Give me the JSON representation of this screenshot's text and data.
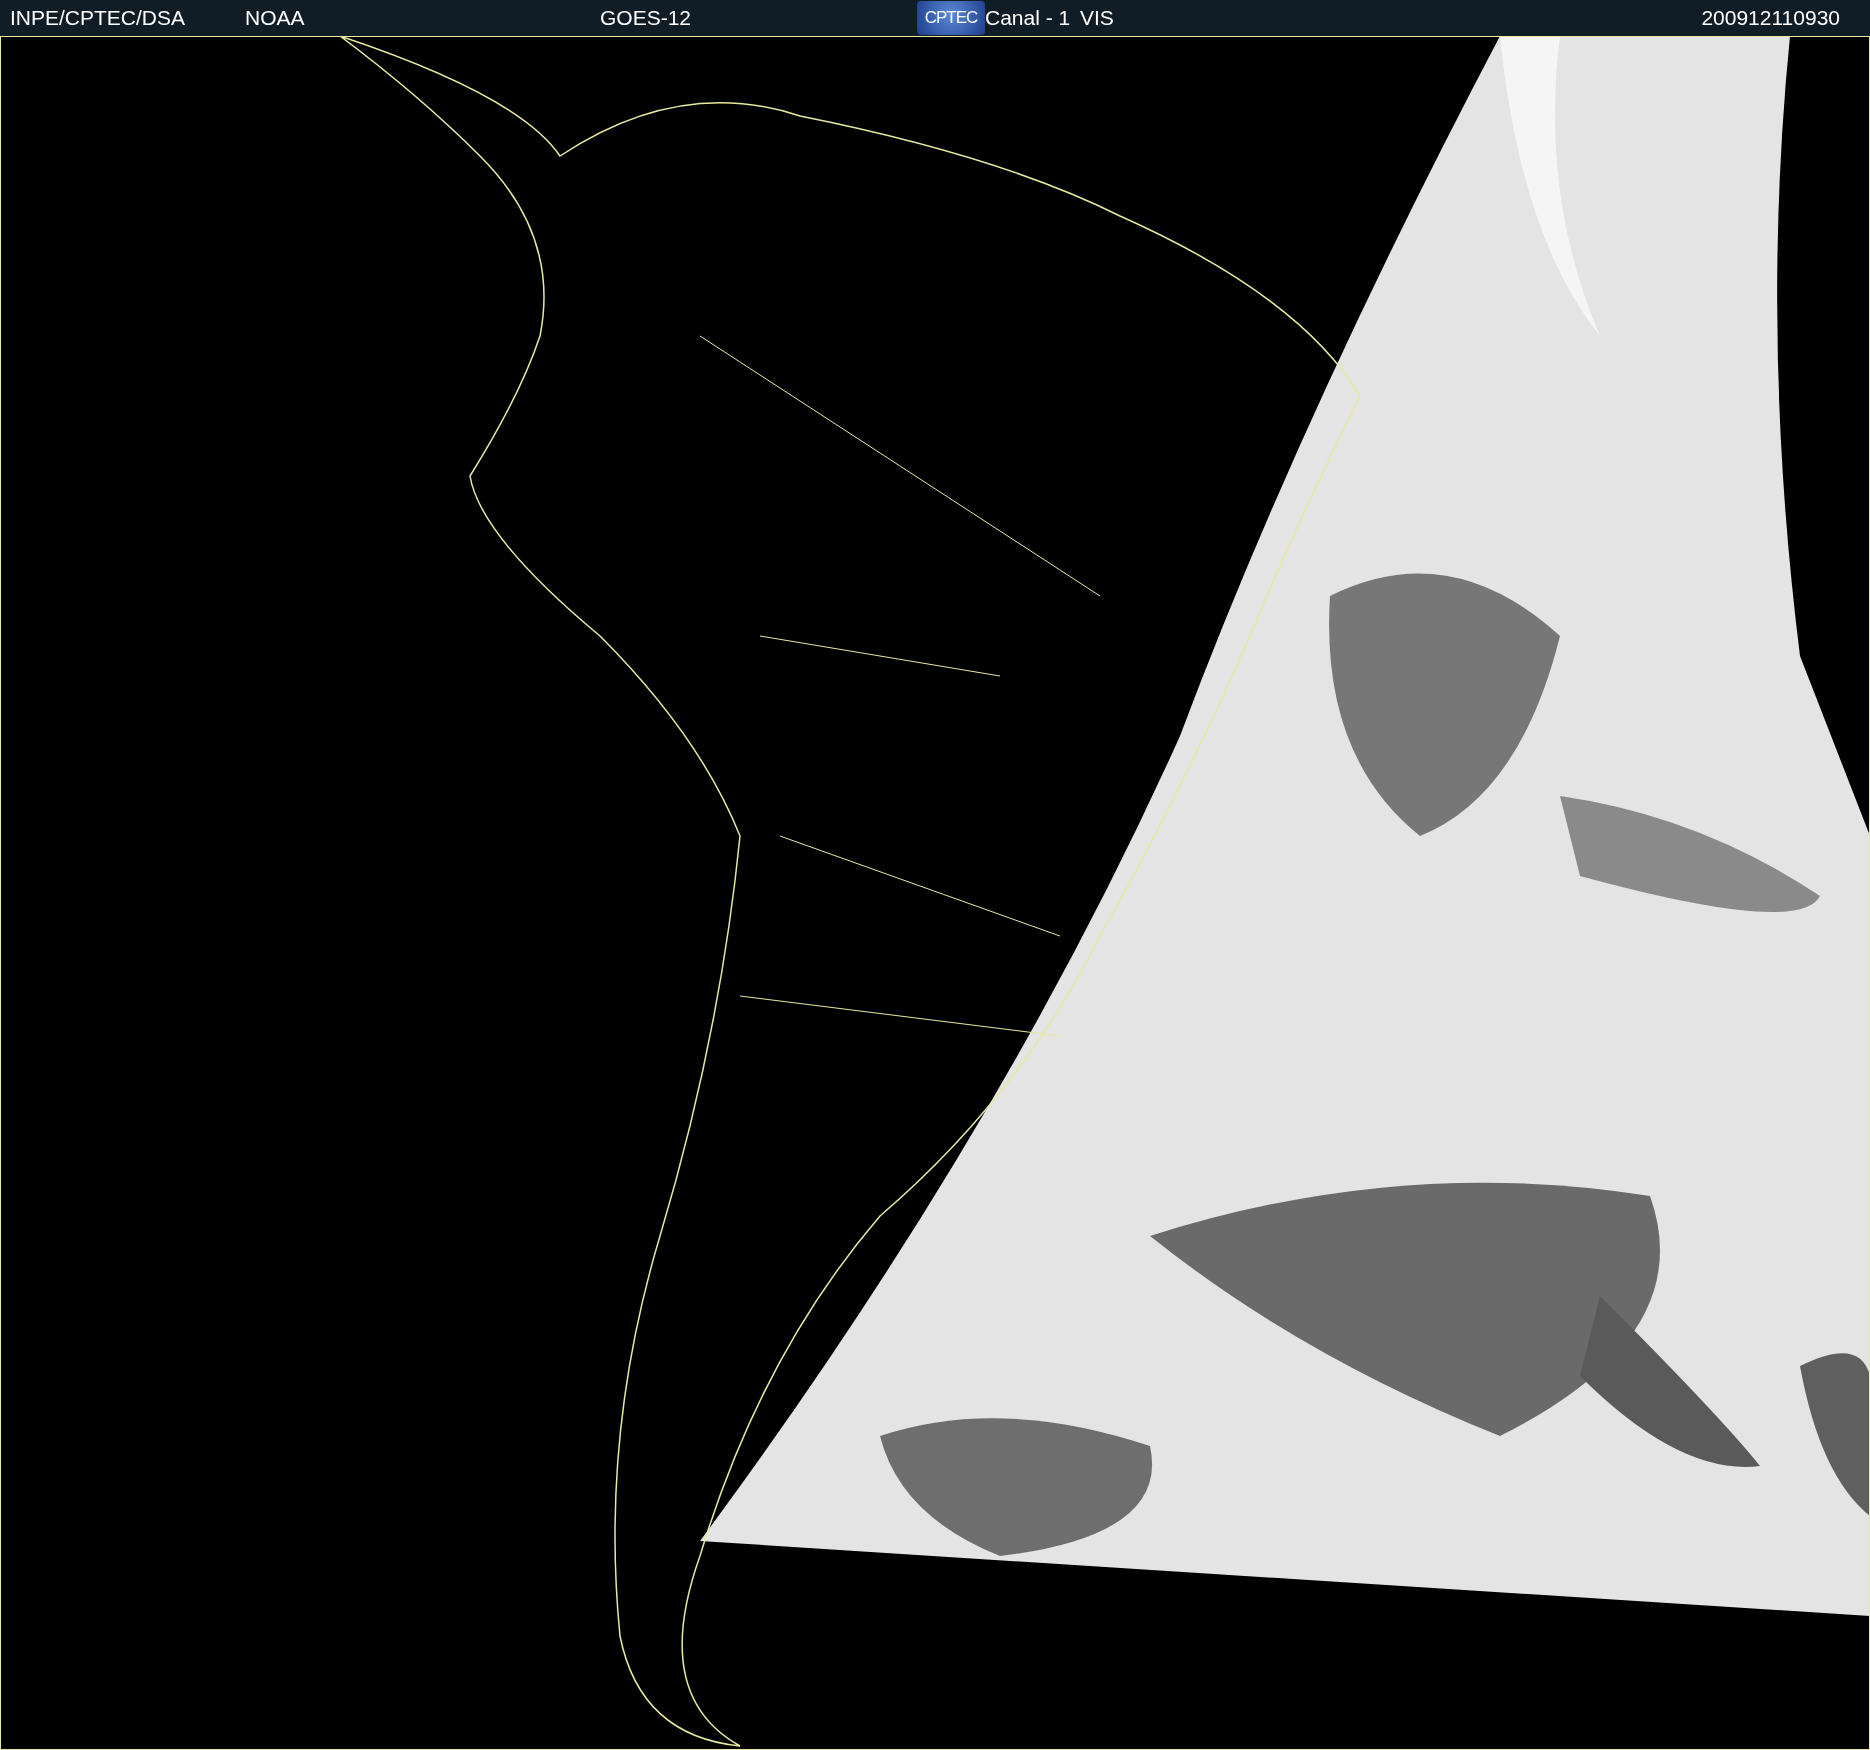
{
  "header": {
    "source": "INPE/CPTEC/DSA",
    "agency": "NOAA",
    "satellite": "GOES-12",
    "logo_text": "CPTEC",
    "channel": "Canal - 1",
    "band": "VIS",
    "timestamp": "200912110930"
  }
}
